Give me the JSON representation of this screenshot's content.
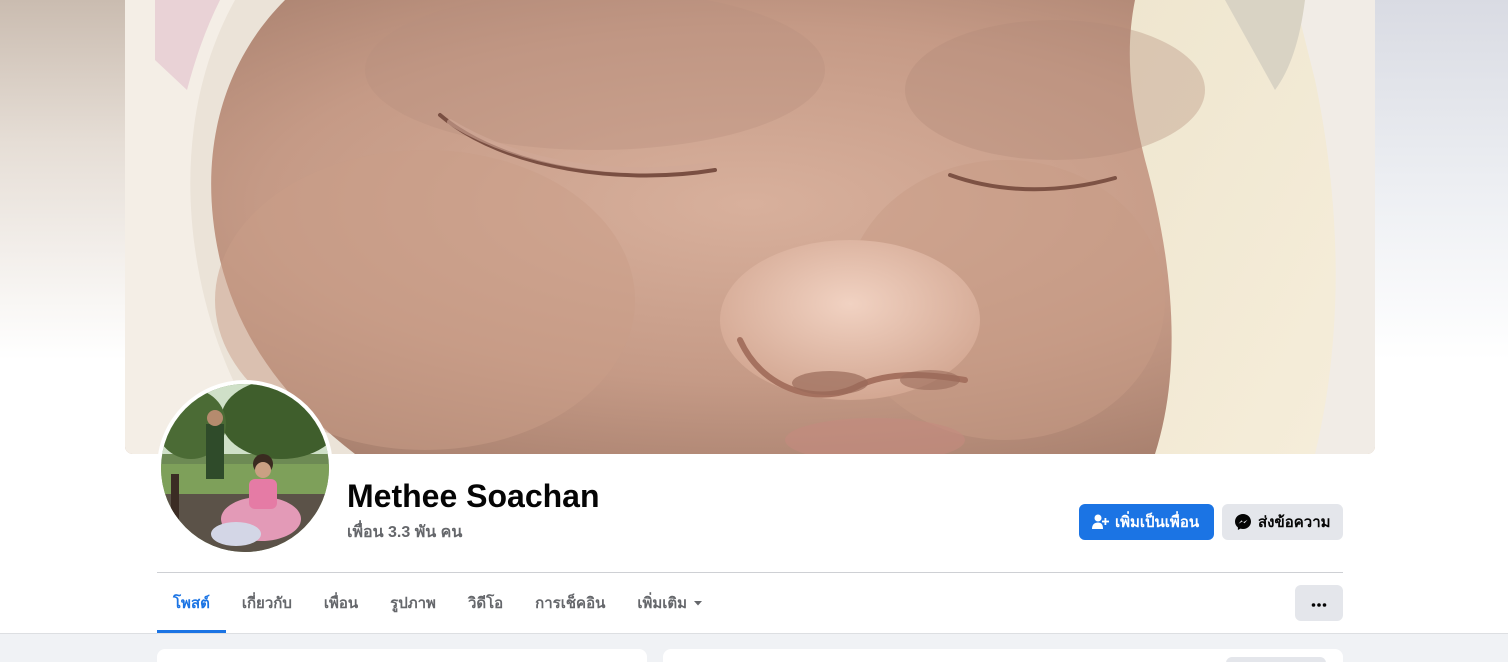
{
  "profile": {
    "name": "Methee Soachan",
    "friends_text": "เพื่อน 3.3 พัน คน"
  },
  "actions": {
    "add_friend_label": "เพิ่มเป็นเพื่อน",
    "message_label": "ส่งข้อความ"
  },
  "tabs": [
    {
      "label": "โพสต์",
      "active": true
    },
    {
      "label": "เกี่ยวกับ",
      "active": false
    },
    {
      "label": "เพื่อน",
      "active": false
    },
    {
      "label": "รูปภาพ",
      "active": false
    },
    {
      "label": "วิดีโอ",
      "active": false
    },
    {
      "label": "การเช็คอิน",
      "active": false
    },
    {
      "label": "เพิ่มเติม",
      "active": false
    }
  ],
  "icons": {
    "add_friend": "add-friend-icon",
    "messenger": "messenger-icon",
    "more_caret": "caret-down-icon",
    "more_options": "ellipsis-icon"
  },
  "colors": {
    "accent": "#1b74e4",
    "secondary_button": "#e4e6eb",
    "muted_text": "#65676b",
    "feed_background": "#f0f2f5"
  }
}
